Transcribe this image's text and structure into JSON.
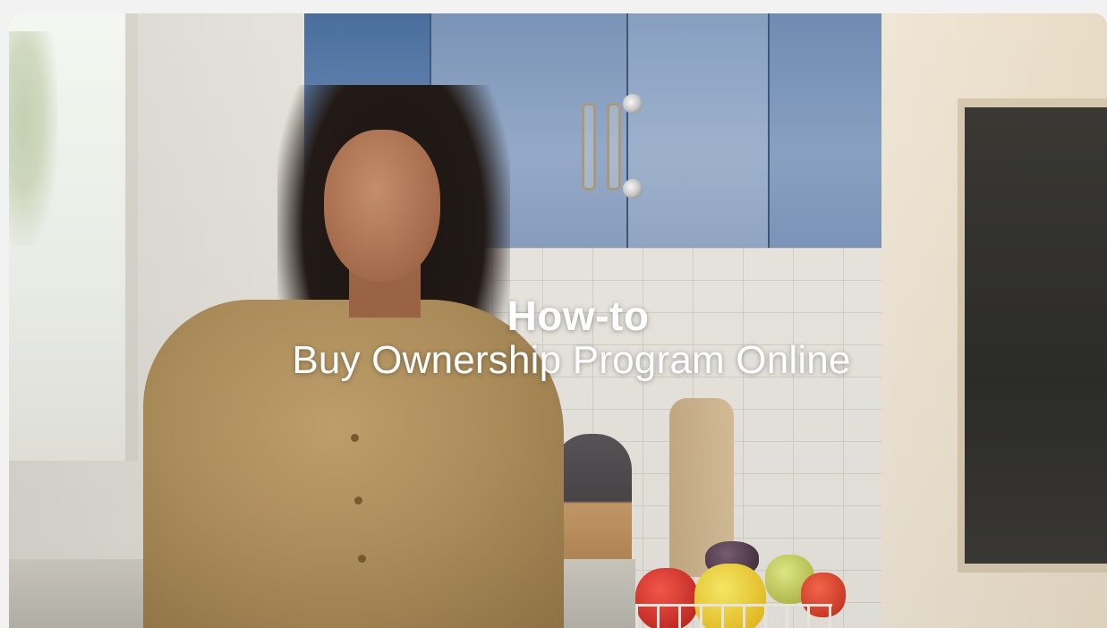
{
  "video": {
    "title_line1": "How-to",
    "title_line2": "Buy Ownership Program Online"
  },
  "colors": {
    "page_background": "#f2f2f2",
    "title_text": "#ffffff",
    "cabinet_blue": "#7d99bf",
    "sweater": "#b0905d"
  }
}
